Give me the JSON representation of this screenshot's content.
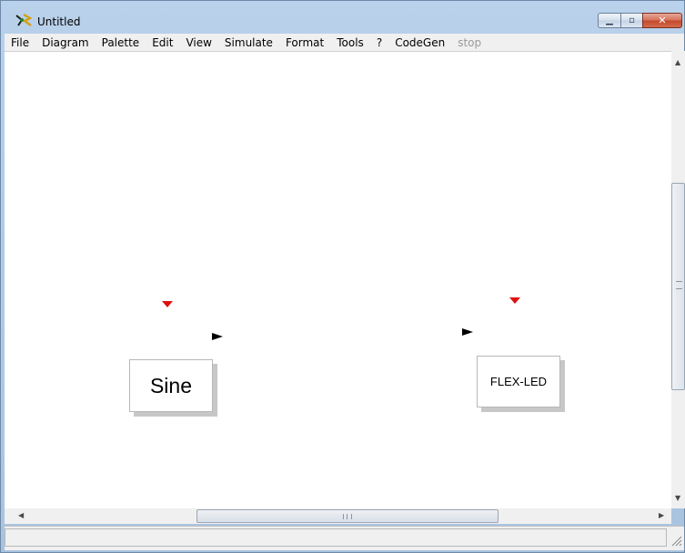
{
  "window": {
    "title": "Untitled",
    "app_icon": "scilab-xcos-icon",
    "controls": {
      "minimize_icon": "minimize-icon",
      "maximize_icon": "maximize-icon",
      "close_icon": "close-icon"
    }
  },
  "menubar": {
    "items": [
      {
        "label": "File",
        "enabled": true
      },
      {
        "label": "Diagram",
        "enabled": true
      },
      {
        "label": "Palette",
        "enabled": true
      },
      {
        "label": "Edit",
        "enabled": true
      },
      {
        "label": "View",
        "enabled": true
      },
      {
        "label": "Simulate",
        "enabled": true
      },
      {
        "label": "Format",
        "enabled": true
      },
      {
        "label": "Tools",
        "enabled": true
      },
      {
        "label": "?",
        "enabled": true
      },
      {
        "label": "CodeGen",
        "enabled": true
      },
      {
        "label": "stop",
        "enabled": false
      }
    ]
  },
  "diagram": {
    "blocks": [
      {
        "label": "Sine",
        "ports": [
          "event-input",
          "data-output"
        ]
      },
      {
        "label": "FLEX-LED",
        "ports": [
          "event-input",
          "data-input"
        ]
      }
    ]
  },
  "colors": {
    "event_port": "#e01010",
    "data_port": "#000000",
    "canvas": "#ffffff",
    "close_button": "#c44a2c"
  },
  "statusbar": {
    "text": ""
  }
}
